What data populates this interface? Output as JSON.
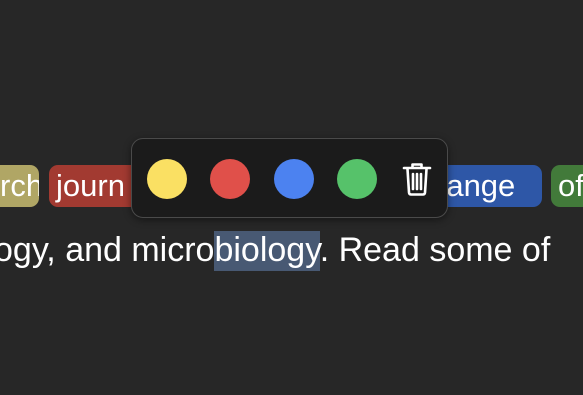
{
  "tags": {
    "first": "rch",
    "second": "journ",
    "third": "range",
    "fourth": "of"
  },
  "body_line": {
    "before": "ogy, and micro",
    "selected": "biology",
    "after": ". Read some of"
  },
  "highlight_colors": [
    {
      "name": "yellow",
      "hex": "#fae063"
    },
    {
      "name": "red",
      "hex": "#e0504a"
    },
    {
      "name": "blue",
      "hex": "#4c82f0"
    },
    {
      "name": "green",
      "hex": "#56c26a"
    }
  ],
  "actions": {
    "delete_icon": "trash-icon"
  }
}
